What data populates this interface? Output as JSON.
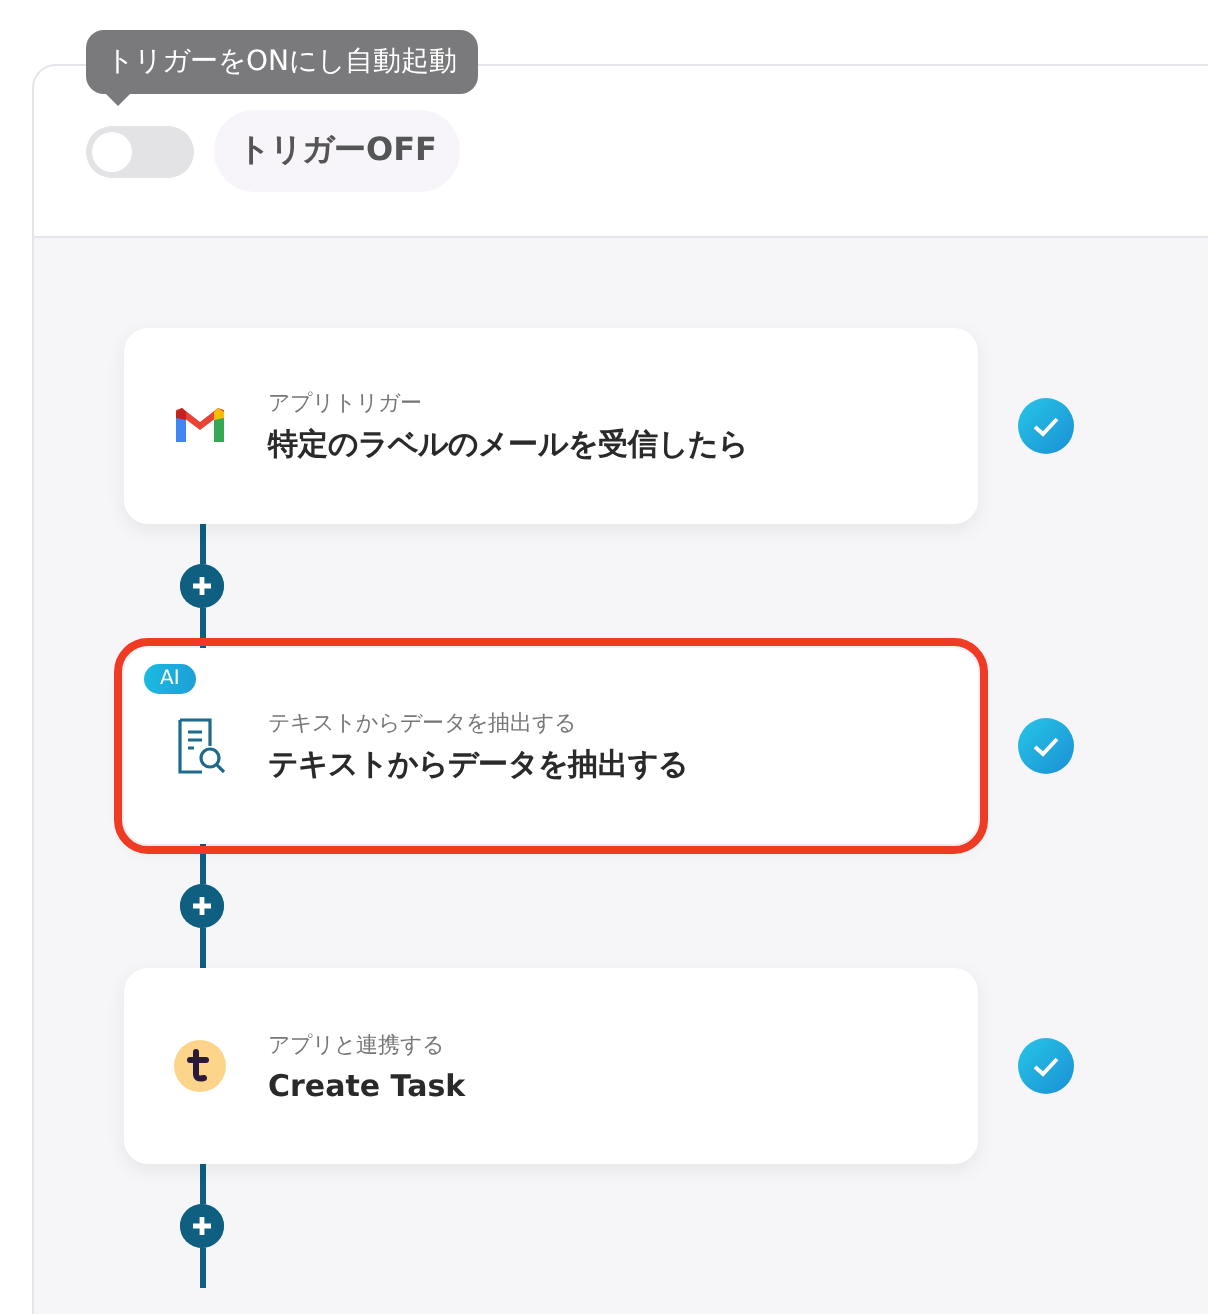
{
  "trigger": {
    "tooltip": "トリガーをONにし自動起動",
    "on": false,
    "label": "トリガーOFF"
  },
  "steps": [
    {
      "kind": "gmail",
      "label": "アプリトリガー",
      "title": "特定のラベルのメールを受信したら",
      "highlighted": false,
      "completed": true
    },
    {
      "kind": "ai",
      "badge": "AI",
      "label": "テキストからデータを抽出する",
      "title": "テキストからデータを抽出する",
      "highlighted": true,
      "completed": true
    },
    {
      "kind": "app",
      "label": "アプリと連携する",
      "title": "Create Task",
      "highlighted": false,
      "completed": true
    }
  ]
}
